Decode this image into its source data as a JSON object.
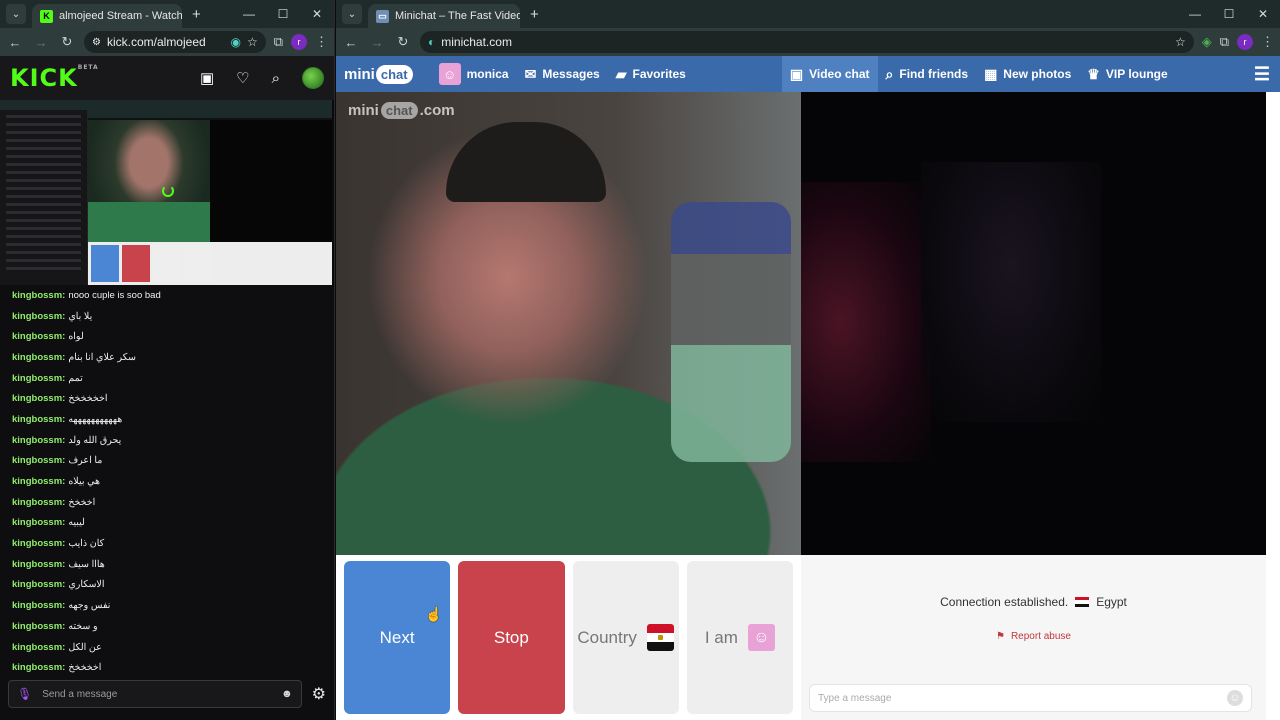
{
  "left_browser": {
    "tab_title": "almojeed Stream - Watch Live o",
    "url": "kick.com/almojeed",
    "profile_letter": "r"
  },
  "kick": {
    "logo": "KICK",
    "logo_badge": "BETA",
    "chat": [
      {
        "user": "kingbossm:",
        "text": "nooo cuple is soo bad"
      },
      {
        "user": "kingbossm:",
        "text": "يلا باي"
      },
      {
        "user": "kingbossm:",
        "text": "لواه"
      },
      {
        "user": "kingbossm:",
        "text": "سكر علاي انا بنام"
      },
      {
        "user": "kingbossm:",
        "text": "تمم"
      },
      {
        "user": "kingbossm:",
        "text": "اخخخخخخ"
      },
      {
        "user": "kingbossm:",
        "text": "هههههههههههه"
      },
      {
        "user": "kingbossm:",
        "text": "يحرق الله ولد"
      },
      {
        "user": "kingbossm:",
        "text": "ما اعرف"
      },
      {
        "user": "kingbossm:",
        "text": "هي بيلاه"
      },
      {
        "user": "kingbossm:",
        "text": "اخخخخ"
      },
      {
        "user": "kingbossm:",
        "text": "ليبيه"
      },
      {
        "user": "kingbossm:",
        "text": "كان ذايب"
      },
      {
        "user": "kingbossm:",
        "text": "هااا سيف"
      },
      {
        "user": "kingbossm:",
        "text": "الاسكاري"
      },
      {
        "user": "kingbossm:",
        "text": "نفس وجهه"
      },
      {
        "user": "kingbossm:",
        "text": "و سخته"
      },
      {
        "user": "kingbossm:",
        "text": "عن الكل"
      },
      {
        "user": "kingbossm:",
        "text": "اخخخخخ"
      }
    ],
    "message_placeholder": "Send a message"
  },
  "right_browser": {
    "tab_title": "Minichat – The Fast Video C",
    "url": "minichat.com",
    "profile_letter": "r"
  },
  "minichat": {
    "logo_a": "mini",
    "logo_b": "chat",
    "nav": {
      "user": "monica",
      "messages": "Messages",
      "favorites": "Favorites",
      "video_chat": "Video chat",
      "find_friends": "Find friends",
      "new_photos": "New photos",
      "vip_lounge": "VIP lounge"
    },
    "watermark_a": "mini",
    "watermark_b": "chat",
    "watermark_c": ".com",
    "buttons": {
      "next": "Next",
      "stop": "Stop",
      "country": "Country",
      "iam": "I am"
    },
    "status": "Connection established.",
    "country_name": "Egypt",
    "report": "Report abuse",
    "message_placeholder": "Type a message"
  }
}
